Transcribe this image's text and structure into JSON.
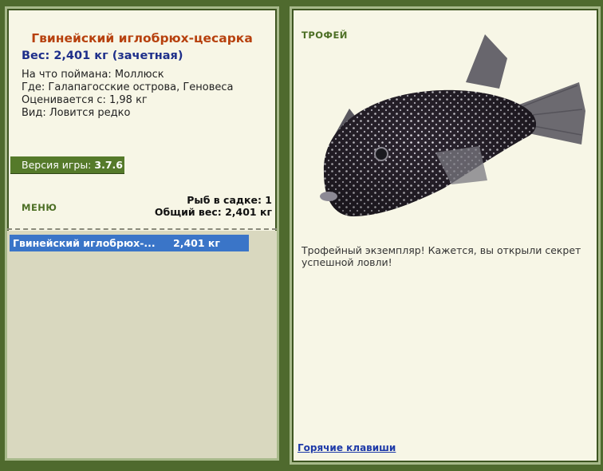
{
  "fish": {
    "title": "Гвинейский иглобрюх-цесарка",
    "weight_line": "Вес: 2,401 кг (зачетная)",
    "bait": "На что поймана: Моллюск",
    "where": "Где: Галапагосские острова, Геновеса",
    "valued": "Оценивается с: 1,98 кг",
    "type": "Вид: Ловится редко"
  },
  "version": {
    "label": "Версия игры:",
    "value": "3.7.6"
  },
  "menu_label": "МЕНЮ",
  "keepnet": {
    "count_line": "Рыб в садке: 1",
    "total_line": "Общий вес: 2,401 кг",
    "items": [
      {
        "name": "Гвинейский иглобрюх-...",
        "weight": "2,401 кг"
      }
    ]
  },
  "trophy": {
    "title": "ТРОФЕЙ",
    "text": "Трофейный экземпляр! Кажется, вы открыли секрет успешной ловли!"
  },
  "hotkeys_label": "Горячие клавиши",
  "colors": {
    "frame": "#4f6a2e",
    "panel": "#f7f6e6",
    "accent_title": "#b7410e",
    "selected_row": "#3a75c8"
  },
  "icons": {
    "fish_image": "guineafowl-puffer-fish"
  }
}
